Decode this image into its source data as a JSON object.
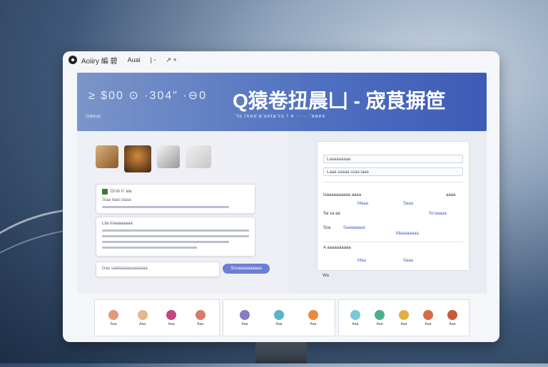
{
  "window": {
    "app_title": "Aoiiry 編 碧",
    "toolbar_items": [
      "Auai",
      "| -",
      "↗ +"
    ]
  },
  "banner": {
    "left_text": "≥ $00   ⊙ ·304\" ·⊖0",
    "title": "Q猿卷扭晨凵 - 宬茛摒笸",
    "sub_left": "Gaeuo",
    "subtitle": "'ts Inoo'a'oota'cs  I  ɞ :····  'aaeɞ"
  },
  "chat": {
    "msg1_head": "Di'sh Ir' ala",
    "msg1_line": "Siaa tiaai siaaa",
    "msg2_head": "Lila maaaaaaaa",
    "input_placeholder": "Daa saalaaaaaaaaaaaa",
    "send_label": "Sssaaaaaaaaaa"
  },
  "form": {
    "field1": "Laaaaaaaaa",
    "field2": "Laaa  saaaa  ssaa  iaaa",
    "row1_left": "Isaaaaaaaaaa aaaa",
    "row1_right": "aaaa",
    "row2_label": "Sa sa aa",
    "row2_v1": "Maaa",
    "row2_v2": "Saaa",
    "row2_v3": "Ss'aaaaa",
    "row3_label": "Ssa",
    "row3_v1": "Saaaaaaaa",
    "row3_v2": "Maaaaaaaa",
    "row4_label": "A aaaaaaaaaa",
    "row4_v1": "Maa",
    "row4_v2": "Saaa",
    "footer": "Wa"
  },
  "apps": {
    "group1": [
      "Aaa",
      "Aaa",
      "Aaa",
      "Aaa"
    ],
    "group2": [
      "Aaa",
      "Aaa",
      "Aaa"
    ],
    "group3": [
      "Aaa",
      "Aaa",
      "Aaa",
      "Aaa",
      "Aaa"
    ]
  },
  "colors": {
    "banner_start": "#7b95c9",
    "banner_end": "#3d5bb5",
    "send_button": "#6c7fd6"
  }
}
